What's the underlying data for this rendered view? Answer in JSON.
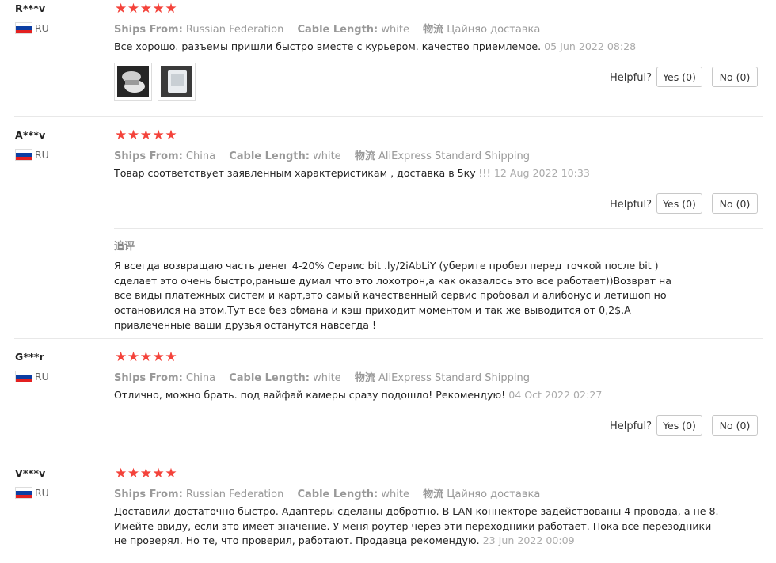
{
  "labels": {
    "ships_from": "Ships From:",
    "cable_length": "Cable Length:",
    "shipping": "物流",
    "helpful": "Helpful?",
    "yes": "Yes (0)",
    "no": "No (0)",
    "additional": "追评"
  },
  "stars": [
    "★",
    "★",
    "★",
    "★",
    "★"
  ],
  "reviews": [
    {
      "user": "R***v",
      "country": "RU",
      "ships_from": "Russian Federation",
      "cable_length": "white",
      "shipping": "Цайняо доставка",
      "text": "Все хорошо. разъемы пришли быстро вместе с курьером. качество приемлемое.",
      "date": "05 Jun 2022 08:28"
    },
    {
      "user": "A***v",
      "country": "RU",
      "ships_from": "China",
      "cable_length": "white",
      "shipping": "AliExpress Standard Shipping",
      "text": "Товар соответствует заявленным характеристикам , доставка в 5ку !!!",
      "date": "12 Aug 2022 10:33",
      "additional_lines": [
        "Я всегда возвращаю часть денег 4-20% Сервис bit .ly/2iAbLiY (уберите пробел перед точкой после bit )",
        "сделает это очень быстро,раньше думал что это лохотрон,а как оказалось это все работает))Возврат на",
        "все виды платежных систем и карт,это самый качественный сервис пробовал и алибонус и летишоп но",
        "остановился на этом.Тут все без обмана и кэш приходит моментом и так же выводится от 0,2$.А",
        "привлеченные ваши друзья останутся навсегда !"
      ]
    },
    {
      "user": "G***r",
      "country": "RU",
      "ships_from": "China",
      "cable_length": "white",
      "shipping": "AliExpress Standard Shipping",
      "text": "Отлично, можно брать. под вайфай камеры сразу подошло! Рекомендую!",
      "date": "04 Oct 2022 02:27"
    },
    {
      "user": "V***v",
      "country": "RU",
      "ships_from": "Russian Federation",
      "cable_length": "white",
      "shipping": "Цайняо доставка",
      "text_lines": [
        "Доставили достаточно быстро. Адаптеры сделаны добротно. В LAN коннекторе задействованы 4 провода, а не 8.",
        "Имейте ввиду, если это имеет значение. У меня роутер через эти переходники работает. Пока все перезодники",
        "не проверял. Но те, что проверил, работают. Продавца рекомендую."
      ],
      "date": "23 Jun 2022 00:09"
    }
  ]
}
